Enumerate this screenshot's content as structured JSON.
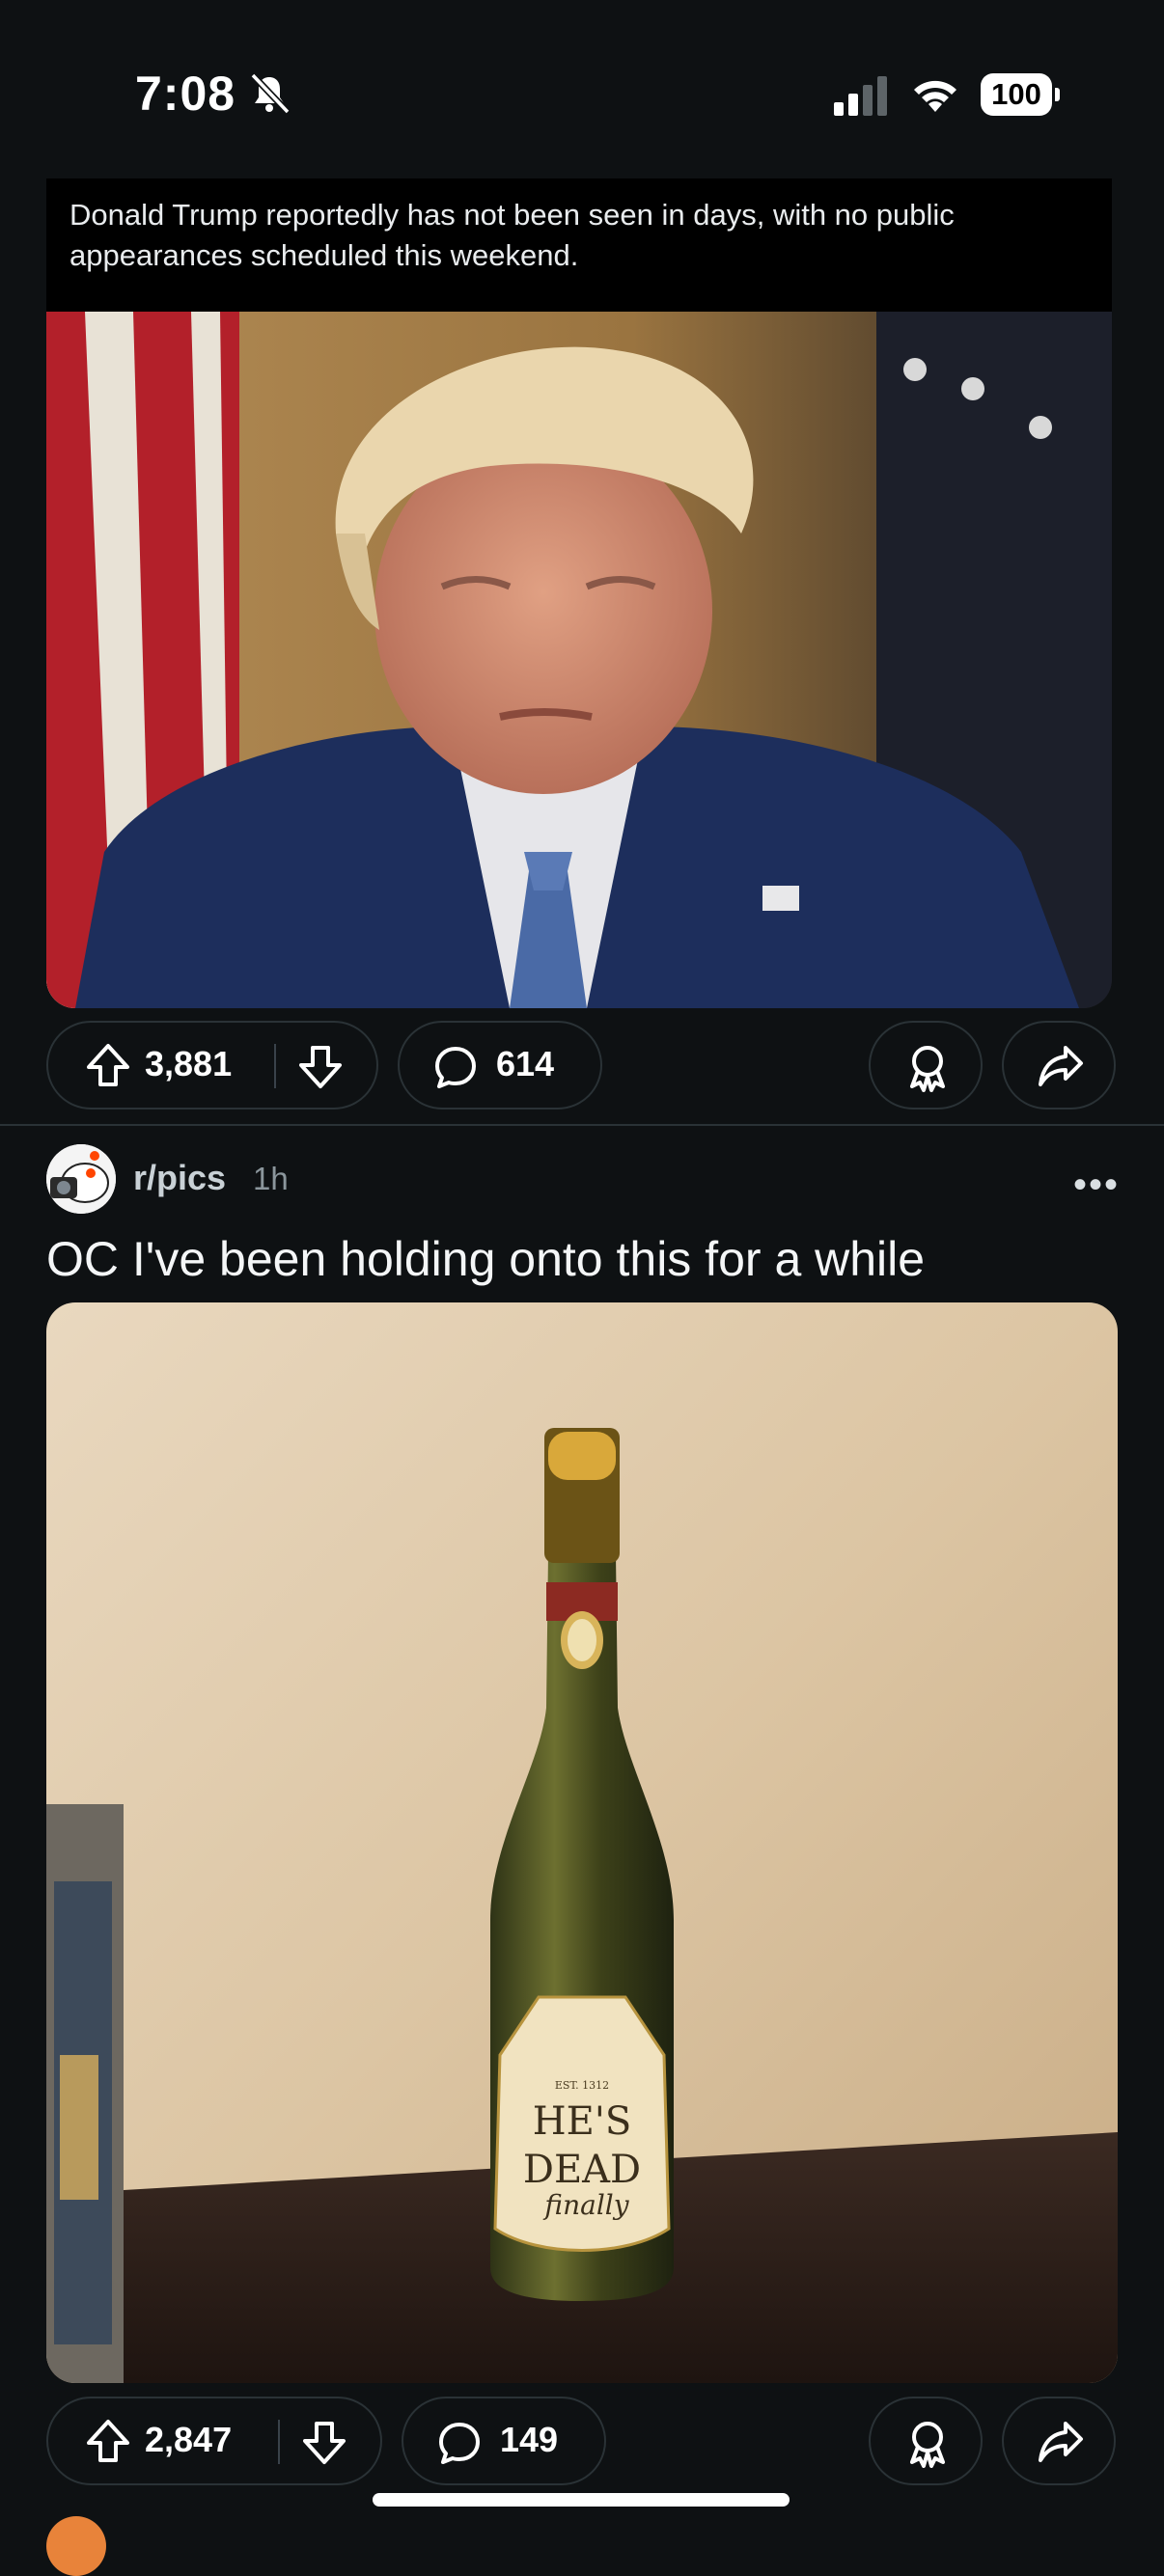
{
  "status_bar": {
    "time": "7:08",
    "battery": "100"
  },
  "post1": {
    "body_text": "Donald Trump reportedly has not been seen in days, with no public appearances scheduled this weekend.",
    "upvotes": "3,881",
    "comments": "614"
  },
  "post2": {
    "subreddit": "r/pics",
    "age": "1h",
    "title": "OC I've been holding onto this for a while",
    "label_est": "EST. 1312",
    "label_main_1": "HE'S",
    "label_main_2": "DEAD",
    "label_script": "finally",
    "upvotes": "2,847",
    "comments": "149"
  },
  "icons": [
    "bell-slash-icon",
    "signal-icon",
    "wifi-icon",
    "battery-icon",
    "upvote-icon",
    "downvote-icon",
    "comment-icon",
    "award-icon",
    "share-icon",
    "more-icon"
  ]
}
